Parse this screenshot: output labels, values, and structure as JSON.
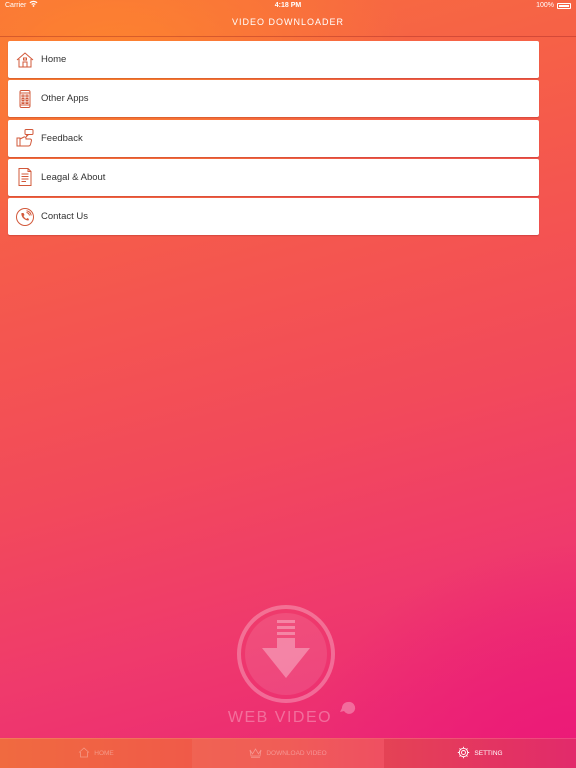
{
  "status_bar": {
    "carrier": "Carrier",
    "time": "4:18 PM",
    "battery": "100%"
  },
  "nav": {
    "title": "VIDEO DOWNLOADER"
  },
  "menu": {
    "items": [
      {
        "label": "Home",
        "icon": "home-icon"
      },
      {
        "label": "Other Apps",
        "icon": "phone-apps-icon"
      },
      {
        "label": "Feedback",
        "icon": "feedback-hand-icon"
      },
      {
        "label": "Leagal & About",
        "icon": "document-icon"
      },
      {
        "label": "Contact Us",
        "icon": "phone-call-icon"
      }
    ]
  },
  "watermark": {
    "text": "WEB VIDEO"
  },
  "tabs": [
    {
      "label": "HOME",
      "icon": "home-icon",
      "active": false
    },
    {
      "label": "DOWNLOAD VIDEO",
      "icon": "crown-icon",
      "active": false
    },
    {
      "label": "SETTING",
      "icon": "gear-icon",
      "active": true
    }
  ],
  "colors": {
    "gradient_top": "#f8703c",
    "gradient_bottom": "#ea2277",
    "icon_accent": "#d2583a",
    "menu_background": "#ffffff"
  }
}
